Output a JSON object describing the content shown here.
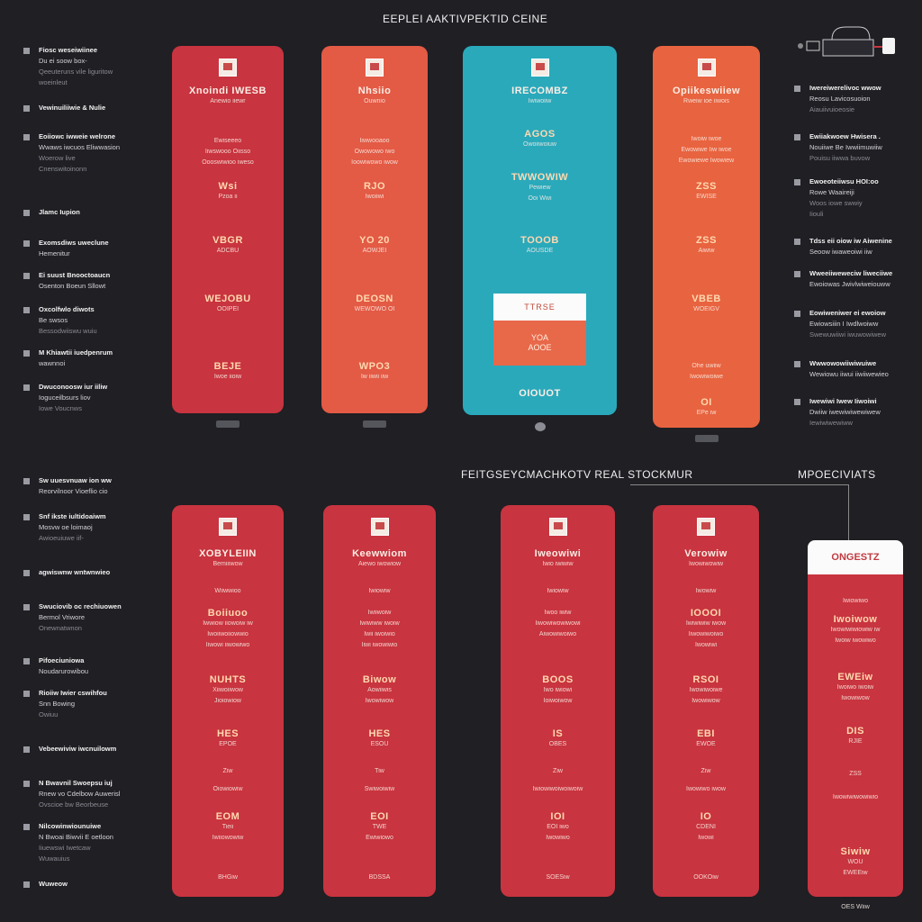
{
  "header": {
    "top_title": "EEPLEI AAKTIVPEKTID CEINE",
    "mid_title": "FEITGSEYCMACHKOTV REAL STOCKMUR",
    "right_title": "MPOECIVIATS"
  },
  "colors": {
    "background": "#1f1f24",
    "card_red": "#c8343f",
    "card_coral": "#e35a45",
    "card_teal": "#2aa9bb",
    "card_orange": "#e8633f",
    "text_light": "#fbeee6",
    "white_header": "#fbfbfb"
  },
  "left_sidebar_top": [
    {
      "icon": "doc-icon",
      "lines": [
        "Fiosc weseiwiinee",
        "Du ei soow box-",
        "Qeeuteruns vile liguritow",
        "woeinleut"
      ]
    },
    {
      "icon": "doc-icon",
      "lines": [
        "Vewinuiliiwie & Nulie"
      ]
    },
    {
      "icon": "doc-icon",
      "lines": [
        "Eoiiowc iwweie welrone",
        "Wwaws iwcuos Eliwwasion",
        "Woerow live",
        "Cnenswitoinonn"
      ]
    },
    {
      "icon": "doc-icon",
      "lines": [
        "Jlamc Iupion"
      ]
    },
    {
      "icon": "doc-icon",
      "lines": [
        "Exomsdiws uweclune",
        "Hemenitur"
      ]
    },
    {
      "icon": "doc-icon",
      "lines": [
        "Ei suust Bnooctoaucn",
        "Osenton Boeun Sllowt"
      ]
    },
    {
      "icon": "doc-icon",
      "lines": [
        "Oxcolfwlo diwots",
        "Be swsos",
        "Bessodwiiswu wuiu"
      ]
    },
    {
      "icon": "doc-icon",
      "lines": [
        "M Khiawtii iuedpenrum",
        "wawnnoi"
      ]
    },
    {
      "icon": "doc-icon",
      "lines": [
        "Dwuconoosw iur iiliw",
        "Ioguceilbsurs liov",
        "Iowe Voucnws"
      ]
    }
  ],
  "left_sidebar_bottom": [
    {
      "icon": "doc-icon",
      "lines": [
        "Sw uuesvnuaw ion ww",
        "Reorvilnoor Vioeflio cio"
      ]
    },
    {
      "icon": "doc-icon",
      "lines": [
        "Snf ikste iultidoaiwm",
        "Mosvw oe loimaoj",
        "Awioeuiuwe iif-"
      ]
    },
    {
      "icon": "doc-icon",
      "lines": [
        "agwiswnw wntwnwieo"
      ]
    },
    {
      "icon": "doc-icon",
      "lines": [
        "Swuciovib oc rechiuowen",
        "Bermol Vriwore",
        "Onewnatwnon"
      ]
    },
    {
      "icon": "doc-icon",
      "lines": [
        "Pifoeciuniowa",
        "Noudarurowibou"
      ]
    },
    {
      "icon": "doc-icon",
      "lines": [
        "Rioiiw Iwier cswihfou",
        "Snn Bowing",
        "Owiuu"
      ]
    },
    {
      "icon": "doc-icon",
      "lines": [
        "Vebeewiviw iwcnuilowm"
      ]
    },
    {
      "icon": "doc-icon",
      "lines": [
        "N Bwavnil Swoepsu iuj",
        "Rnew vo Cdelbow Auwerisl",
        "Ovscioe bw Beorbeuse"
      ]
    },
    {
      "icon": "doc-icon",
      "lines": [
        "Nilcowinwiounuiwe",
        "N Bwoai Biwvii E oetloon",
        "Iiuewswi Iwetcaw",
        "Wuwauius"
      ]
    },
    {
      "icon": "doc-icon",
      "lines": [
        "Wuweow"
      ]
    }
  ],
  "right_sidebar": [
    {
      "icon": "doc-icon",
      "lines": [
        "Iwereiwerelivoc wwow",
        "Reosu Lavicosuoion",
        "Aiauiivuioeosie"
      ]
    },
    {
      "icon": "doc-icon",
      "lines": [
        "Ewiiakwoew Hwisera .",
        "Nouiiwe Be Iwwiimuwiiw",
        "Pouisu iiwwa buvow"
      ]
    },
    {
      "icon": "doc-icon",
      "lines": [
        "Ewoeoteiiwsu HOI:oo",
        "Rowe Waaireiji",
        "Woos iowe swwiy",
        "Iiouli"
      ]
    },
    {
      "icon": "doc-icon",
      "lines": [
        "Tdss eii oiow iw Aiwenine",
        "Seoow iwaweoiwi iiw"
      ]
    },
    {
      "icon": "doc-icon",
      "lines": [
        "Wweeiiweweciw liweciiwe",
        "Ewoiowas Jwivlwiweiouww"
      ]
    },
    {
      "icon": "doc-icon",
      "lines": [
        "Eowiweniwer ei ewoiow",
        "Ewiowsiiin I Iwdlwoiww",
        "Swewuwiiwi iwuwowiwew"
      ]
    },
    {
      "icon": "doc-icon",
      "lines": [
        "Wwwowowiiwiwuiwe",
        "Wewiowu iiwui iiwiiwewieo"
      ]
    },
    {
      "icon": "doc-icon",
      "lines": [
        "Iwewiwi Iwew Iiwoiwi",
        "Dwiiw iwewiwiwewiwew",
        "Iewiwiwewiww"
      ]
    }
  ],
  "top_cards": [
    {
      "color": "#c8343f",
      "title": "Xnoindi IWESB",
      "subtitle": "Anewio iiewr",
      "blocks": [
        [
          "Ewiseeeo",
          "Iiwswooo Oiisso",
          "Oooswiwioo iweso"
        ],
        [
          "Wsi",
          "Pzoa ii"
        ],
        [
          "VBGR",
          "ADCBU"
        ],
        [
          "WEJOBU",
          "OOIPEI"
        ],
        [
          "BEJE",
          "Iwoe iioiw"
        ]
      ],
      "footer": ""
    },
    {
      "color": "#e35a45",
      "title": "Nhsiio",
      "subtitle": "Ouwnio",
      "blocks": [
        [
          "Iiwwooaoo",
          "Owowowo iwo",
          "Ioowiwowo iwow"
        ],
        [
          "RJO",
          "Iwoiiwi"
        ],
        [
          "YO 20",
          "AOWJEI"
        ],
        [
          "DEOSN",
          "WEWOWO OI"
        ],
        [
          "WPO3",
          "Iw iiwii iiw"
        ]
      ],
      "footer": ""
    },
    {
      "color": "#2aa9bb",
      "title": "IRECOMBZ",
      "subtitle": "Iwiwoiiw",
      "blocks": [
        [
          "AGOS",
          "Owoiiwoiuw"
        ],
        [
          "TWWOWIW",
          "Pewiew",
          "Ooi Wwi"
        ],
        [
          "TOOOB",
          "AOUSDE"
        ]
      ],
      "inset": {
        "head": "TTRSE",
        "line1": "YOA",
        "line2": "AOOE"
      },
      "footer": "OIOUOT"
    },
    {
      "color": "#e8633f",
      "title": "Opiikeswiiew",
      "subtitle": "Rweiw ioe iiwois",
      "blocks": [
        [
          "Iwoiw iwoe",
          "Ewowiwe Iiw iwoe",
          "Ewowiewe Iwowiew"
        ],
        [
          "ZSS",
          "EWISE"
        ],
        [
          "ZSS",
          "Aiwiw"
        ],
        [
          "VBEB",
          "WOEIGV"
        ],
        [
          "Ohe uwiiw",
          "Iwowiwoiwe"
        ],
        [
          "OI",
          "EPe iw"
        ]
      ],
      "footer": ""
    }
  ],
  "bottom_cards": [
    {
      "color": "#c8343f",
      "title": "XOBYLEIIN",
      "subtitle": "Bemiiiwow",
      "blocks": [
        [
          "Wiiwwioo"
        ],
        [
          "Boiiuoo",
          "Iwwiow iiowoiw iw",
          "Iwoiiwoiiowwio",
          "Iiwowi iiwowiwo"
        ],
        [
          "NUHTS",
          "Xiiwoiiwow",
          "Jioiowiow"
        ],
        [
          "HES",
          "EPOE"
        ],
        [
          "Ziw"
        ],
        [
          "Oiowiowiw"
        ],
        [
          "EOM",
          "Tieii",
          "Iwiiowowiw"
        ],
        [
          "BHGiw"
        ]
      ],
      "footer": ""
    },
    {
      "color": "#c8343f",
      "title": "Keewwiom",
      "subtitle": "Aiewo iwowiow",
      "blocks": [
        [
          "Iwiowiw"
        ],
        [
          "Iwiiwoiw",
          "Iwiwiww iwoiw",
          "Iwii iwoiwio",
          "Iiwi iwowiwio"
        ],
        [
          "Biwow",
          "Aowiiwis",
          "Iwowiwow"
        ],
        [
          "HES",
          "ESOU"
        ],
        [
          "Tiw"
        ],
        [
          "Swiwoiwiw"
        ],
        [
          "EOI",
          "TWE",
          "Ewiwiowo"
        ],
        [
          "BDSSA"
        ]
      ],
      "footer": ""
    },
    {
      "color": "#c8343f",
      "title": "Iweowiwi",
      "subtitle": "Iwio iwiwiw",
      "blocks": [
        [
          "Iwiowiw"
        ],
        [
          "Iwoo iwiw",
          "Iiwowiwowiwowi",
          "Aiwowiwoiwo"
        ],
        [
          "BOOS",
          "Iwo iwiowi",
          "Ioiwoiwow"
        ],
        [
          "IS",
          "OBES"
        ],
        [
          "Ziw"
        ],
        [
          "Iwiowiwoiwoiwoiw"
        ],
        [
          "IOI",
          "EOI iwo",
          "Iwowiwo"
        ],
        [
          "SOESiw"
        ]
      ],
      "footer": ""
    },
    {
      "color": "#c8343f",
      "title": "Verowiw",
      "subtitle": "Iwowiwowiw",
      "blocks": [
        [
          "Iwowiw"
        ],
        [
          "IOOOI",
          "Iwiwiwiw iwow",
          "Iiwowiwoiwo",
          "Iwowiwi"
        ],
        [
          "RSOI",
          "Iwowiwoiwe",
          "Iwowiwow"
        ],
        [
          "EBI",
          "EWOE"
        ],
        [
          "Ziw"
        ],
        [
          "Iwowiwo iwow"
        ],
        [
          "IO",
          "CDENI",
          "Iwowi"
        ],
        [
          "OOKOiw"
        ]
      ],
      "footer": ""
    },
    {
      "color": "#c8343f",
      "title": "ONGESTZ",
      "white_header": true,
      "subtitle": "",
      "blocks": [
        [
          "Iwiowiwo"
        ],
        [
          "Iwoiwow",
          "Iwowiwiwiowiw iw",
          "Iwoiw iwowiwo"
        ],
        [
          "EWEiw",
          "Iwoiwo iwoiw",
          "Iwowiwow"
        ],
        [
          "DIS",
          "RJIE"
        ],
        [
          "ZSS"
        ],
        [
          "Iwowiwiwowiwio"
        ],
        [
          "Siwiw",
          "WOU",
          "EWEEiw"
        ],
        [
          "OES Wiiw"
        ]
      ],
      "footer": ""
    }
  ],
  "device_label": "device-diagram"
}
